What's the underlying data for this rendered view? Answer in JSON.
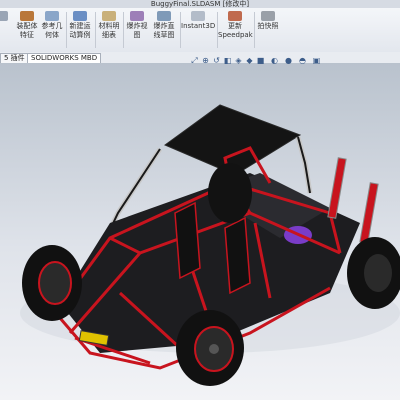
{
  "window": {
    "title": "BuggyFinal.SLDASM [修改中]"
  },
  "ribbon": {
    "items": [
      {
        "label_1": "装配体",
        "label_2": "特征"
      },
      {
        "label_1": "参考几",
        "label_2": "何体"
      },
      {
        "label_1": "新建运",
        "label_2": "动算例"
      },
      {
        "label_1": "材料明",
        "label_2": "细表"
      },
      {
        "label_1": "爆炸视",
        "label_2": "图"
      },
      {
        "label_1": "爆炸直",
        "label_2": "线草图"
      },
      {
        "label_1": "Instant3D",
        "label_2": ""
      },
      {
        "label_1": "更新",
        "label_2": "Speedpak"
      },
      {
        "label_1": "拍快照",
        "label_2": ""
      }
    ]
  },
  "tabs": [
    {
      "label": "5 插件"
    },
    {
      "label": "SOLIDWORKS MBD"
    }
  ],
  "colors": {
    "frame": "#c8141e",
    "body": "#1c1c1e",
    "roof": "#111111",
    "accent": "#7a3cc8"
  }
}
